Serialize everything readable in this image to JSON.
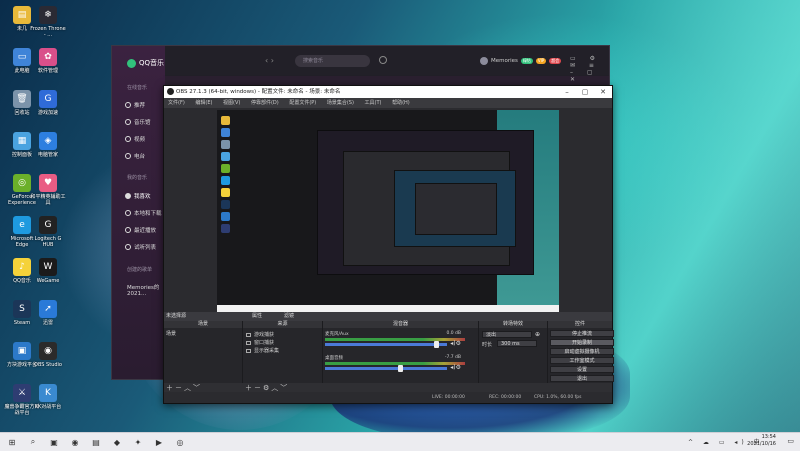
{
  "desktop_icons": [
    {
      "label": "未几",
      "color": "#e8b93a",
      "glyph": "▤"
    },
    {
      "label": "Frozen Throne - ...",
      "color": "#2a2a34",
      "glyph": "❄"
    },
    {
      "label": "此电脑",
      "color": "#3f84d8",
      "glyph": "▭"
    },
    {
      "label": "软件管理",
      "color": "#d94f8a",
      "glyph": "✿"
    },
    {
      "label": "回收站",
      "color": "#7b93aa",
      "glyph": "🗑"
    },
    {
      "label": "游戏加速",
      "color": "#2f6bd8",
      "glyph": "G"
    },
    {
      "label": "控制面板",
      "color": "#4aa3e0",
      "glyph": "▦"
    },
    {
      "label": "电脑管家",
      "color": "#2d7fe0",
      "glyph": "◈"
    },
    {
      "label": "GeForce Experience",
      "color": "#6bb02a",
      "glyph": "◎"
    },
    {
      "label": "和平精英辅助工具",
      "color": "#e95c84",
      "glyph": "♥"
    },
    {
      "label": "Microsoft Edge",
      "color": "#1e9adf",
      "glyph": "e"
    },
    {
      "label": "Logitech G HUB",
      "color": "#222",
      "glyph": "G"
    },
    {
      "label": "QQ音乐",
      "color": "#f5d23a",
      "glyph": "♪"
    },
    {
      "label": "WeGame",
      "color": "#1b1b1b",
      "glyph": "W"
    },
    {
      "label": "Steam",
      "color": "#1b3658",
      "glyph": "S"
    },
    {
      "label": "迅雷",
      "color": "#2a7ad8",
      "glyph": "➚"
    },
    {
      "label": "方块游戏平台",
      "color": "#2c79c9",
      "glyph": "▣"
    },
    {
      "label": "OBS Studio",
      "color": "#2b2b2b",
      "glyph": "◉"
    },
    {
      "label": "魔兽争霸官方对战平台",
      "color": "#2e3d72",
      "glyph": "⚔"
    },
    {
      "label": "KK对战平台",
      "color": "#3a8ad0",
      "glyph": "K"
    }
  ],
  "qq_music": {
    "app_name": "QQ音乐",
    "group_online": "在线音乐",
    "nav_items": [
      "推荐",
      "音乐馆",
      "视频",
      "电台"
    ],
    "group_mine": "我的音乐",
    "mine_items": [
      "我喜欢",
      "本地和下载",
      "最近播放",
      "试听列表"
    ],
    "group_created": "创建的歌单",
    "playlist": "Memories的2021...",
    "search_placeholder": "搜索音乐",
    "user_name": "Memories",
    "badges": [
      {
        "text": "绿钻",
        "color": "#31c27c"
      },
      {
        "text": "VIP",
        "color": "#f5a623"
      },
      {
        "text": "超会",
        "color": "#e0494f"
      }
    ],
    "nav_arrows": "‹ ›",
    "window_controls": "▭ ⚙ ✉ ≡ – ▢ ✕"
  },
  "obs": {
    "title": "OBS 27.1.3 (64-bit, windows) - 配置文件: 未命名 - 场景: 未命名",
    "menu": [
      "文件(F)",
      "编辑(E)",
      "视图(V)",
      "停靠部件(D)",
      "配置文件(P)",
      "场景集合(S)",
      "工具(T)",
      "帮助(H)"
    ],
    "no_source": "未选择源",
    "props_button": "属性",
    "filter_button": "滤镜",
    "headers": {
      "scenes": "场景",
      "sources": "来源",
      "mixer": "混音器",
      "transitions": "转场特效",
      "controls": "控件"
    },
    "scenes": [
      "场景"
    ],
    "sources": [
      "游戏捕获",
      "窗口捕获",
      "显示器采集"
    ],
    "mixer": [
      {
        "name": "麦克风/Aux",
        "db": "0.0 dB",
        "vol": 0.93
      },
      {
        "name": "桌面音频",
        "db": "-7.7 dB",
        "vol": 0.62
      }
    ],
    "transition": {
      "type": "淡出",
      "duration_label": "时长",
      "duration": "300 ms"
    },
    "controls": [
      "停止推流",
      "开始录制",
      "启动虚拟摄像机",
      "工作室模式",
      "设置",
      "退出"
    ],
    "status": {
      "live": "LIVE: 00:00:00",
      "rec": "REC: 00:00:00",
      "cpu": "CPU: 1.0%, 60.00 fps"
    }
  },
  "taskbar": {
    "time": "13:54",
    "date": "2021/10/16",
    "tray": "^ ☁ ▭ ◂) 中",
    "apps": [
      "⊞",
      "⌕",
      "▣",
      "◉",
      "▤",
      "◆",
      "✦",
      "▶",
      "◎"
    ]
  }
}
